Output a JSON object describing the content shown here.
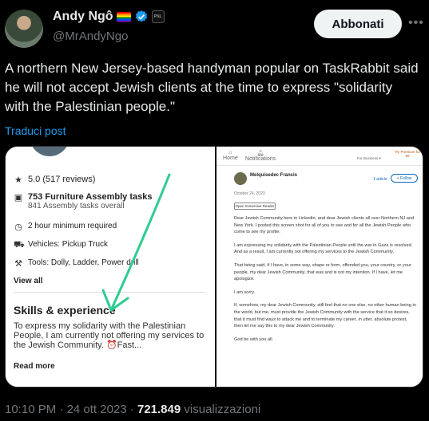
{
  "author": {
    "name": "Andy Ngô",
    "handle": "@MrAndyNgo",
    "follow_label": "Abbonati",
    "affiliation_badge": "PNL"
  },
  "tweet": {
    "text": "A northern New Jersey-based handyman popular on TaskRabbit said he will not accept Jewish clients at the time to express \"solidarity with the Palestinian people.\"",
    "translate_label": "Traduci post"
  },
  "left_screenshot": {
    "rating": "5.0 (517 reviews)",
    "tasks_title": "753 Furniture Assembly tasks",
    "tasks_sub": "841 Assembly tasks overall",
    "minimum": "2 hour minimum required",
    "vehicles": "Vehicles: Pickup Truck",
    "tools": "Tools: Dolly, Ladder, Power drill",
    "view_all": "View all",
    "skills_heading": "Skills & experience",
    "skills_text": "To express my solidarity with the Palestinian People, I am currently not offering my services to the Jewish Community. ⏰Fast...",
    "read_more": "Read more",
    "arrow_color": "#2ecc8f"
  },
  "right_screenshot": {
    "topbar": {
      "home": "Home",
      "notifications": "Notifications",
      "business": "For Business ▾",
      "premium": "Try Premium for €0"
    },
    "author": "Melquisedec Francis",
    "article_count": "1 article",
    "follow": "+ Follow",
    "date": "October 24, 2023",
    "reader": "Open Immersive Reader",
    "paragraphs": [
      "Dear Jewish Community here in Linkedin, and dear Jewish clients all over Northern NJ and New York. I posted this screen shot for all of you to see and for all the Jewish People who come to see my profile.",
      "I am expressing my solidarity with the Palestinian People until the war in Gaza is resolved. And as a result, I am currently not offering my services to the Jewish Community.",
      "That being said, if I have, in some way, shape or form, offended you, your country, or your people, my dear Jewish Community, that was and is not my intention. If I have, let me apologize.",
      "I am sorry.",
      "If, somehow, my dear Jewish Community, still feel that no one else, no other human being in the world, but me, must provide the Jewish Community with the service that it so desires, that it must find ways to attack me and to terminate my career, in utter, absolute protest, then let me say this to my dear Jewish Community:",
      "God be with you all."
    ]
  },
  "meta": {
    "time": "10:10 PM",
    "date": "24 ott 2023",
    "views": "721.849",
    "views_label": "visualizzazioni"
  },
  "colors": {
    "link": "#1d9bf0",
    "verified": "#1d9bf0"
  }
}
